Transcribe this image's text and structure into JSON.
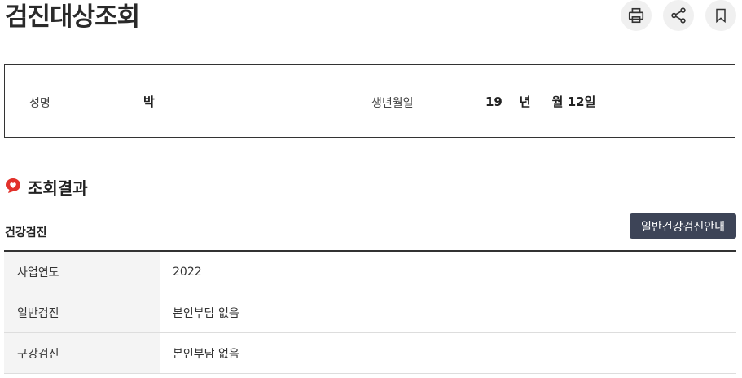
{
  "page": {
    "title": "검진대상조회"
  },
  "actions": {
    "print_icon": "printer-icon",
    "share_icon": "share-icon",
    "bookmark_icon": "bookmark-icon"
  },
  "person": {
    "name_label": "성명",
    "name_value": "박",
    "birth_label": "생년월일",
    "birth_value": "19    년     월 12일"
  },
  "result": {
    "section_title": "조회결과",
    "section_icon": "heart-badge-icon",
    "sub_title": "건강검진",
    "guide_button_label": "일반건강검진안내",
    "rows": [
      {
        "label": "사업연도",
        "value": "2022"
      },
      {
        "label": "일반검진",
        "value": "본인부담 없음"
      },
      {
        "label": "구강검진",
        "value": "본인부담 없음"
      }
    ]
  },
  "colors": {
    "accent_red": "#e2312b",
    "button_dark": "#3d4457",
    "row_header_bg": "#f4f4f4"
  }
}
